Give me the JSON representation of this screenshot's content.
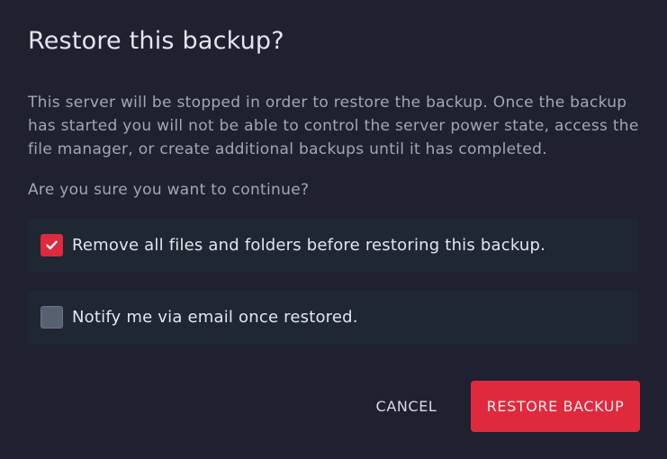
{
  "dialog": {
    "title": "Restore this backup?",
    "description": "This server will be stopped in order to restore the backup. Once the backup has started you will not be able to control the server power state, access the file manager, or create additional backups until it has completed.",
    "question": "Are you sure you want to continue?",
    "options": [
      {
        "label": "Remove all files and folders before restoring this backup.",
        "checked": true
      },
      {
        "label": "Notify me via email once restored.",
        "checked": false
      }
    ],
    "buttons": {
      "cancel_label": "CANCEL",
      "restore_label": "RESTORE BACKUP"
    }
  },
  "colors": {
    "background": "#1f2030",
    "option_background": "#1f2732",
    "accent_red": "#e0293d",
    "text_primary": "#e3e6ec",
    "text_secondary": "#a1a7b3"
  },
  "icons": {
    "checked": "check-icon"
  }
}
